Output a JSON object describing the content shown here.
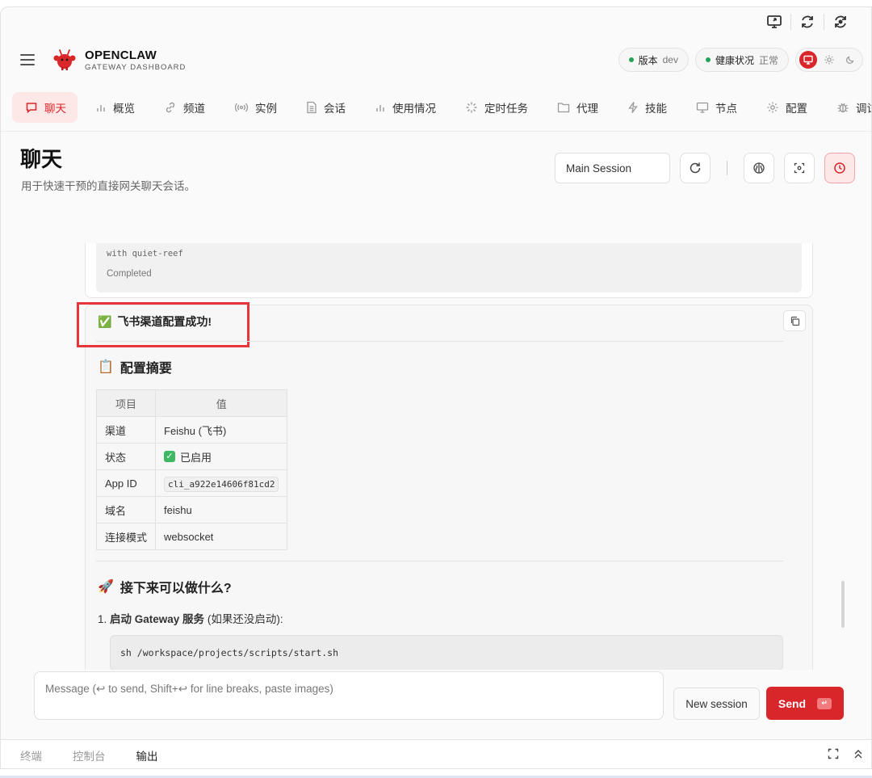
{
  "app": {
    "brand_title": "OPENCLAW",
    "brand_subtitle": "GATEWAY DASHBOARD"
  },
  "status": {
    "version_label": "版本",
    "version_value": "dev",
    "health_label": "健康状况",
    "health_value": "正常"
  },
  "nav": [
    {
      "label": "聊天",
      "icon": "chat-icon",
      "active": true
    },
    {
      "label": "概览",
      "icon": "bar-chart-icon"
    },
    {
      "label": "频道",
      "icon": "link-icon"
    },
    {
      "label": "实例",
      "icon": "broadcast-icon"
    },
    {
      "label": "会话",
      "icon": "document-icon"
    },
    {
      "label": "使用情况",
      "icon": "bar-chart-icon"
    },
    {
      "label": "定时任务",
      "icon": "loader-icon"
    },
    {
      "label": "代理",
      "icon": "folder-icon"
    },
    {
      "label": "技能",
      "icon": "bolt-icon"
    },
    {
      "label": "节点",
      "icon": "monitor-icon"
    },
    {
      "label": "配置",
      "icon": "gear-icon"
    },
    {
      "label": "调试",
      "icon": "bug-icon"
    }
  ],
  "page": {
    "title": "聊天",
    "subtitle": "用于快速干预的直接网关聊天会话。",
    "session_select": "Main Session"
  },
  "previous_card": {
    "line1": "with quiet-reef",
    "line2": "Completed"
  },
  "message": {
    "success_emoji": "✅",
    "success_text": "飞书渠道配置成功!",
    "summary_emoji": "📋",
    "summary_heading": "配置摘要",
    "table_headers": [
      "项目",
      "值"
    ],
    "table_rows": [
      {
        "key": "渠道",
        "value": "Feishu (飞书)"
      },
      {
        "key": "状态",
        "value": "已启用"
      },
      {
        "key": "App ID",
        "value": "cli_a922e14606f81cd2"
      },
      {
        "key": "域名",
        "value": "feishu"
      },
      {
        "key": "连接模式",
        "value": "websocket"
      }
    ],
    "next_emoji": "🚀",
    "next_heading": "接下来可以做什么?",
    "step_number": "1.",
    "step_bold": "启动 Gateway 服务",
    "step_rest": "(如果还没启动):",
    "code": "sh /workspace/projects/scripts/start.sh"
  },
  "composer": {
    "placeholder": "Message (↩ to send, Shift+↩ for line breaks, paste images)",
    "new_session": "New session",
    "send": "Send",
    "send_kbd": "↵"
  },
  "bottom_tabs": [
    {
      "label": "终端",
      "active": false
    },
    {
      "label": "控制台",
      "active": false
    },
    {
      "label": "输出",
      "active": true
    }
  ],
  "colors": {
    "accent": "#d9262a",
    "accent_soft": "#fde7e7",
    "status_ok": "#22a35a",
    "highlight_box": "#e8353a"
  }
}
